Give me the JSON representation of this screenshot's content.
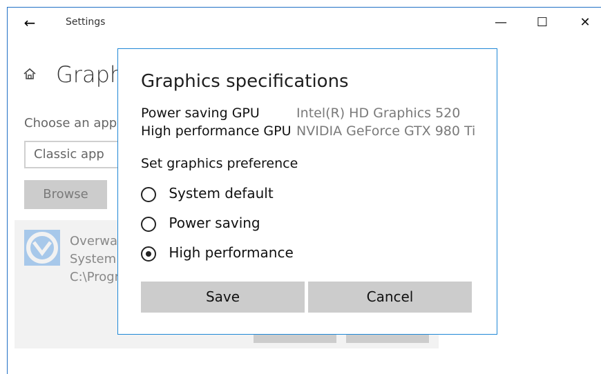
{
  "window": {
    "title": "Settings",
    "back_icon": "arrow-left-icon",
    "controls": [
      "minimize-icon",
      "maximize-icon",
      "close-icon"
    ]
  },
  "background": {
    "heading": "Graph",
    "choose_text": "Choose an app",
    "select_value": "Classic app",
    "browse_label": "Browse",
    "app_lines": [
      "Overwat",
      "System",
      "C:\\Progr"
    ]
  },
  "dialog": {
    "title": "Graphics specifications",
    "specs": [
      {
        "label": "Power saving GPU",
        "value": "Intel(R) HD Graphics 520"
      },
      {
        "label": "High performance GPU",
        "value": "NVIDIA GeForce GTX 980 Ti"
      }
    ],
    "preference_label": "Set graphics preference",
    "options": [
      {
        "label": "System default",
        "selected": false
      },
      {
        "label": "Power saving",
        "selected": false
      },
      {
        "label": "High performance",
        "selected": true
      }
    ],
    "buttons": {
      "save": "Save",
      "cancel": "Cancel"
    }
  }
}
